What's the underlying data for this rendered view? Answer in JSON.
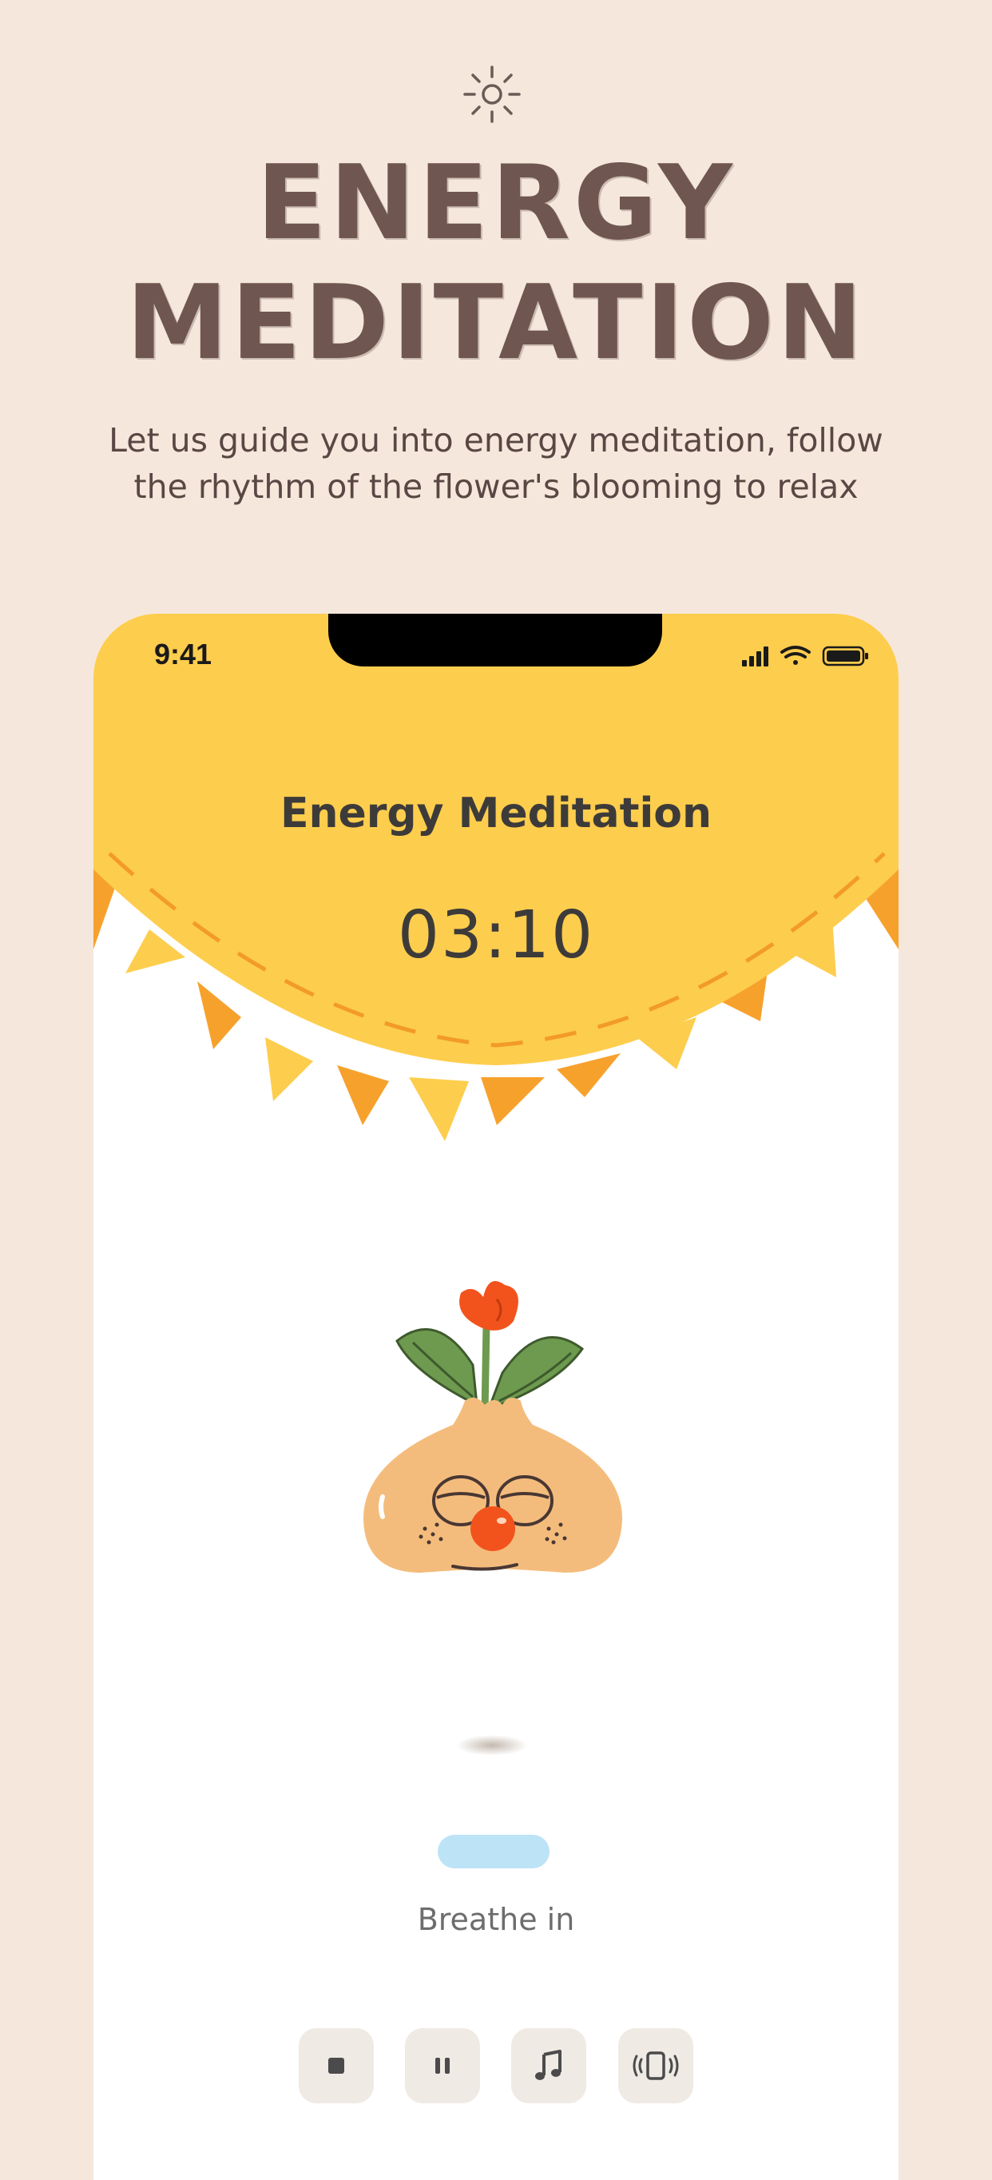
{
  "hero": {
    "title_line1": "ENERGY",
    "title_line2": "MEDITATION",
    "subtitle_line1": "Let us guide you into energy meditation, follow",
    "subtitle_line2": "the rhythm of the flower's blooming to relax",
    "icon": "sun-icon"
  },
  "status_bar": {
    "time": "9:41",
    "icons": [
      "signal-icon",
      "wifi-icon",
      "battery-icon"
    ]
  },
  "app": {
    "title": "Energy Meditation",
    "timer": "03:10",
    "breath_label": "Breathe in"
  },
  "controls": [
    {
      "name": "stop",
      "icon": "stop-icon"
    },
    {
      "name": "pause",
      "icon": "pause-icon"
    },
    {
      "name": "music",
      "icon": "music-note-icon"
    },
    {
      "name": "vibrate",
      "icon": "vibrate-icon"
    }
  ],
  "colors": {
    "background": "#f5e7dc",
    "sun": "#fdcd4d",
    "sun_rays_dark": "#f7a12d",
    "title_text": "#6f5650",
    "breath_bar": "#bde3f7",
    "control_bg": "#efeae4"
  }
}
